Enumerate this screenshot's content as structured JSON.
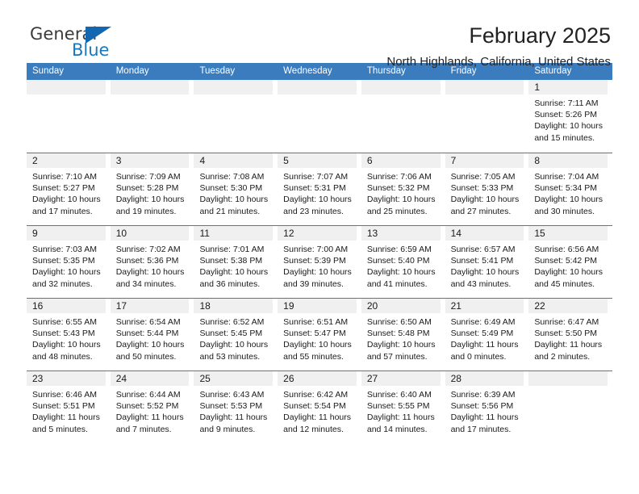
{
  "brand": {
    "name_part1": "General",
    "name_part2": "Blue",
    "accent_color": "#1878be",
    "triangle_color": "#1267b0"
  },
  "header": {
    "title": "February 2025",
    "subtitle": "North Highlands, California, United States"
  },
  "calendar": {
    "header_background": "#3b7cbf",
    "daynum_background": "#f0f0f0",
    "weekdays": [
      "Sunday",
      "Monday",
      "Tuesday",
      "Wednesday",
      "Thursday",
      "Friday",
      "Saturday"
    ],
    "weeks": [
      [
        {
          "day": ""
        },
        {
          "day": ""
        },
        {
          "day": ""
        },
        {
          "day": ""
        },
        {
          "day": ""
        },
        {
          "day": ""
        },
        {
          "day": "1",
          "sunrise": "Sunrise: 7:11 AM",
          "sunset": "Sunset: 5:26 PM",
          "daylight": "Daylight: 10 hours and 15 minutes."
        }
      ],
      [
        {
          "day": "2",
          "sunrise": "Sunrise: 7:10 AM",
          "sunset": "Sunset: 5:27 PM",
          "daylight": "Daylight: 10 hours and 17 minutes."
        },
        {
          "day": "3",
          "sunrise": "Sunrise: 7:09 AM",
          "sunset": "Sunset: 5:28 PM",
          "daylight": "Daylight: 10 hours and 19 minutes."
        },
        {
          "day": "4",
          "sunrise": "Sunrise: 7:08 AM",
          "sunset": "Sunset: 5:30 PM",
          "daylight": "Daylight: 10 hours and 21 minutes."
        },
        {
          "day": "5",
          "sunrise": "Sunrise: 7:07 AM",
          "sunset": "Sunset: 5:31 PM",
          "daylight": "Daylight: 10 hours and 23 minutes."
        },
        {
          "day": "6",
          "sunrise": "Sunrise: 7:06 AM",
          "sunset": "Sunset: 5:32 PM",
          "daylight": "Daylight: 10 hours and 25 minutes."
        },
        {
          "day": "7",
          "sunrise": "Sunrise: 7:05 AM",
          "sunset": "Sunset: 5:33 PM",
          "daylight": "Daylight: 10 hours and 27 minutes."
        },
        {
          "day": "8",
          "sunrise": "Sunrise: 7:04 AM",
          "sunset": "Sunset: 5:34 PM",
          "daylight": "Daylight: 10 hours and 30 minutes."
        }
      ],
      [
        {
          "day": "9",
          "sunrise": "Sunrise: 7:03 AM",
          "sunset": "Sunset: 5:35 PM",
          "daylight": "Daylight: 10 hours and 32 minutes."
        },
        {
          "day": "10",
          "sunrise": "Sunrise: 7:02 AM",
          "sunset": "Sunset: 5:36 PM",
          "daylight": "Daylight: 10 hours and 34 minutes."
        },
        {
          "day": "11",
          "sunrise": "Sunrise: 7:01 AM",
          "sunset": "Sunset: 5:38 PM",
          "daylight": "Daylight: 10 hours and 36 minutes."
        },
        {
          "day": "12",
          "sunrise": "Sunrise: 7:00 AM",
          "sunset": "Sunset: 5:39 PM",
          "daylight": "Daylight: 10 hours and 39 minutes."
        },
        {
          "day": "13",
          "sunrise": "Sunrise: 6:59 AM",
          "sunset": "Sunset: 5:40 PM",
          "daylight": "Daylight: 10 hours and 41 minutes."
        },
        {
          "day": "14",
          "sunrise": "Sunrise: 6:57 AM",
          "sunset": "Sunset: 5:41 PM",
          "daylight": "Daylight: 10 hours and 43 minutes."
        },
        {
          "day": "15",
          "sunrise": "Sunrise: 6:56 AM",
          "sunset": "Sunset: 5:42 PM",
          "daylight": "Daylight: 10 hours and 45 minutes."
        }
      ],
      [
        {
          "day": "16",
          "sunrise": "Sunrise: 6:55 AM",
          "sunset": "Sunset: 5:43 PM",
          "daylight": "Daylight: 10 hours and 48 minutes."
        },
        {
          "day": "17",
          "sunrise": "Sunrise: 6:54 AM",
          "sunset": "Sunset: 5:44 PM",
          "daylight": "Daylight: 10 hours and 50 minutes."
        },
        {
          "day": "18",
          "sunrise": "Sunrise: 6:52 AM",
          "sunset": "Sunset: 5:45 PM",
          "daylight": "Daylight: 10 hours and 53 minutes."
        },
        {
          "day": "19",
          "sunrise": "Sunrise: 6:51 AM",
          "sunset": "Sunset: 5:47 PM",
          "daylight": "Daylight: 10 hours and 55 minutes."
        },
        {
          "day": "20",
          "sunrise": "Sunrise: 6:50 AM",
          "sunset": "Sunset: 5:48 PM",
          "daylight": "Daylight: 10 hours and 57 minutes."
        },
        {
          "day": "21",
          "sunrise": "Sunrise: 6:49 AM",
          "sunset": "Sunset: 5:49 PM",
          "daylight": "Daylight: 11 hours and 0 minutes."
        },
        {
          "day": "22",
          "sunrise": "Sunrise: 6:47 AM",
          "sunset": "Sunset: 5:50 PM",
          "daylight": "Daylight: 11 hours and 2 minutes."
        }
      ],
      [
        {
          "day": "23",
          "sunrise": "Sunrise: 6:46 AM",
          "sunset": "Sunset: 5:51 PM",
          "daylight": "Daylight: 11 hours and 5 minutes."
        },
        {
          "day": "24",
          "sunrise": "Sunrise: 6:44 AM",
          "sunset": "Sunset: 5:52 PM",
          "daylight": "Daylight: 11 hours and 7 minutes."
        },
        {
          "day": "25",
          "sunrise": "Sunrise: 6:43 AM",
          "sunset": "Sunset: 5:53 PM",
          "daylight": "Daylight: 11 hours and 9 minutes."
        },
        {
          "day": "26",
          "sunrise": "Sunrise: 6:42 AM",
          "sunset": "Sunset: 5:54 PM",
          "daylight": "Daylight: 11 hours and 12 minutes."
        },
        {
          "day": "27",
          "sunrise": "Sunrise: 6:40 AM",
          "sunset": "Sunset: 5:55 PM",
          "daylight": "Daylight: 11 hours and 14 minutes."
        },
        {
          "day": "28",
          "sunrise": "Sunrise: 6:39 AM",
          "sunset": "Sunset: 5:56 PM",
          "daylight": "Daylight: 11 hours and 17 minutes."
        },
        {
          "day": ""
        }
      ]
    ]
  }
}
